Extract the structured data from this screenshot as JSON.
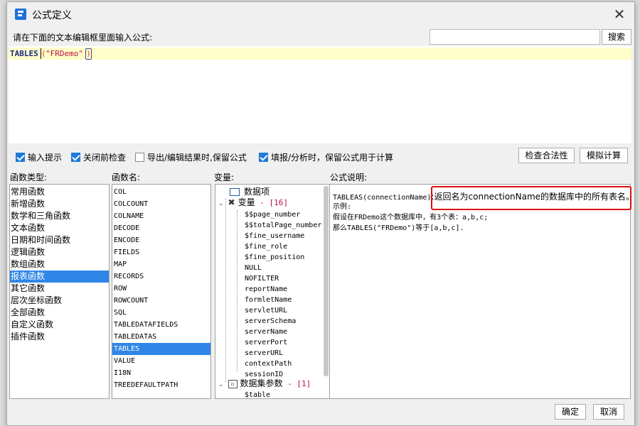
{
  "window": {
    "title": "公式定义",
    "close_label": "✕"
  },
  "editor": {
    "prompt": "请在下面的文本编辑框里面输入公式:",
    "search_value": "",
    "search_button": "搜索",
    "formula": {
      "function": "TABLES",
      "open_paren": "(",
      "argument": "\"FRDemo\"",
      "close_paren": ")"
    }
  },
  "options": [
    {
      "label": "输入提示",
      "checked": true
    },
    {
      "label": "关闭前检查",
      "checked": true
    },
    {
      "label": "导出/编辑结果时,保留公式",
      "checked": false
    },
    {
      "label": "填报/分析时，保留公式用于计算",
      "checked": true
    }
  ],
  "actions": {
    "validate": "检查合法性",
    "simulate": "模拟计算"
  },
  "categories": {
    "label": "函数类型:",
    "items": [
      "常用函数",
      "新增函数",
      "数学和三角函数",
      "文本函数",
      "日期和时间函数",
      "逻辑函数",
      "数组函数",
      "报表函数",
      "其它函数",
      "层次坐标函数",
      "全部函数",
      "自定义函数",
      "插件函数"
    ],
    "selected_index": 7
  },
  "functions": {
    "label": "函数名:",
    "items": [
      "COL",
      "COLCOUNT",
      "COLNAME",
      "DECODE",
      "ENCODE",
      "FIELDS",
      "MAP",
      "RECORDS",
      "ROW",
      "ROWCOUNT",
      "SQL",
      "TABLEDATAFIELDS",
      "TABLEDATAS",
      "TABLES",
      "VALUE",
      "I18N",
      "TREEDEFAULTPATH"
    ],
    "selected_index": 13
  },
  "variables": {
    "label": "变量:",
    "data_item": "数据项",
    "var_group": {
      "label": "变量",
      "count_text": " - [16]"
    },
    "var_items": [
      "$$page_number",
      "$$totalPage_number",
      "$fine_username",
      "$fine_role",
      "$fine_position",
      "NULL",
      "NOFILTER",
      "reportName",
      "formletName",
      "servletURL",
      "serverSchema",
      "serverName",
      "serverPort",
      "serverURL",
      "contextPath",
      "sessionID"
    ],
    "ds_group": {
      "label": "数据集参数",
      "count_text": " - [1]"
    },
    "ds_items": [
      "$table"
    ]
  },
  "description": {
    "label": "公式说明:",
    "signature": "TABLEAS(connectionName)",
    "summary": ":返回名为connectionName的数据库中的所有表名。",
    "example_title": "示例:",
    "example_line1": "假设在FRDemo这个数据库中，有3个表：a,b,c;",
    "example_line2": "那么TABLES(\"FRDemo\")等于[a,b,c]."
  },
  "footer": {
    "ok": "确定",
    "cancel": "取消"
  }
}
